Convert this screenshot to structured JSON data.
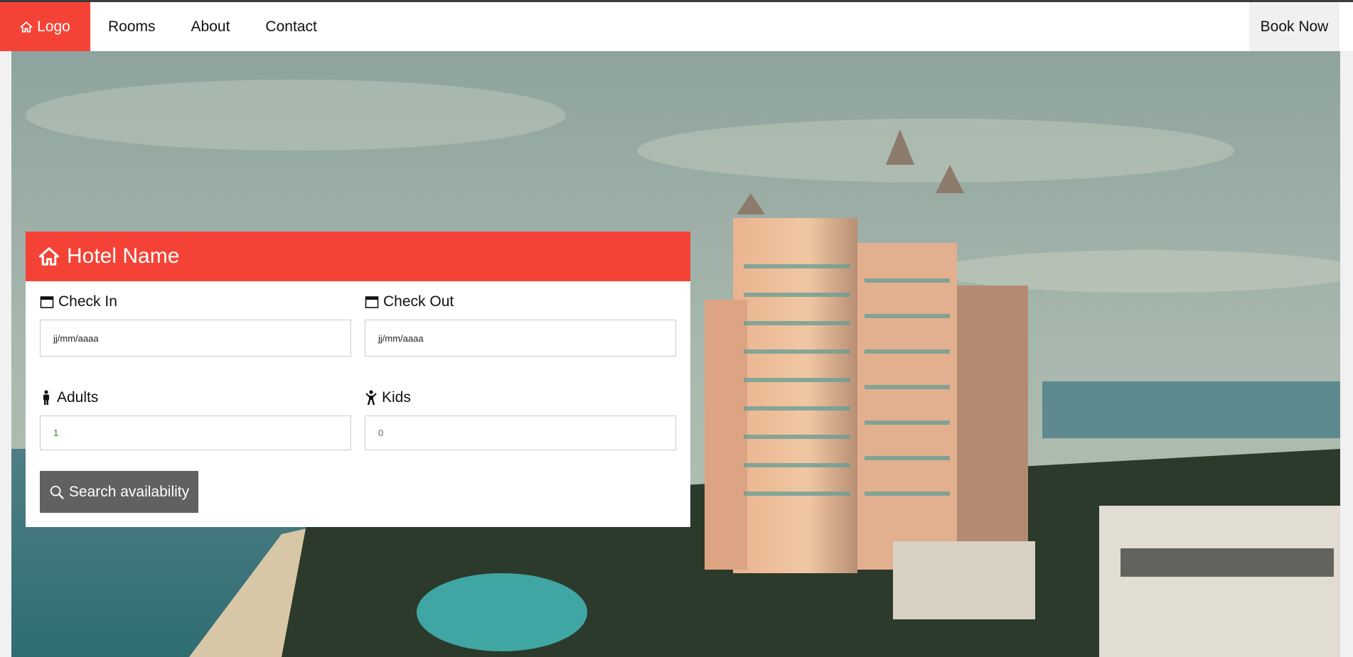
{
  "nav": {
    "logo_label": "Logo",
    "items": [
      {
        "label": "Rooms"
      },
      {
        "label": "About"
      },
      {
        "label": "Contact"
      }
    ],
    "book_label": "Book Now"
  },
  "hero_image": "Aerial photo of a large beachfront resort hotel with pool, palm trees and ocean",
  "booking": {
    "title": "Hotel Name",
    "check_in": {
      "label": "Check In",
      "value": "jj/mm/aaaa",
      "icon": "calendar-icon"
    },
    "check_out": {
      "label": "Check Out",
      "value": "jj/mm/aaaa",
      "icon": "calendar-icon"
    },
    "adults": {
      "label": "Adults",
      "value": "1",
      "icon": "male-icon"
    },
    "kids": {
      "label": "Kids",
      "value": "0",
      "icon": "child-icon"
    },
    "search_label": "Search availability"
  },
  "colors": {
    "accent": "#f44336",
    "button": "#616161"
  }
}
